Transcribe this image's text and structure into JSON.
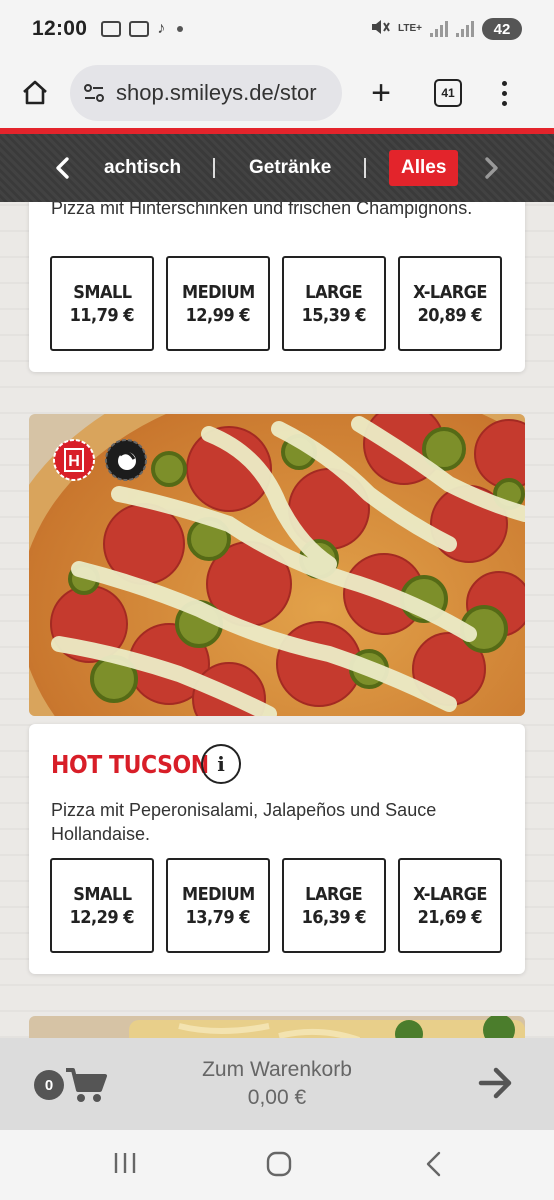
{
  "status_bar": {
    "time": "12:00",
    "network": "LTE+",
    "battery": "42"
  },
  "browser": {
    "url": "shop.smileys.de/stor",
    "tab_count": "41"
  },
  "categories": {
    "items": [
      "achtisch",
      "Getränke",
      "Alles"
    ],
    "active": "Alles"
  },
  "products": [
    {
      "description": "Pizza mit Hinterschinken und frischen Champignons.",
      "sizes": [
        {
          "name": "SMALL",
          "price": "11,79 €"
        },
        {
          "name": "MEDIUM",
          "price": "12,99 €"
        },
        {
          "name": "LARGE",
          "price": "15,39 €"
        },
        {
          "name": "X-LARGE",
          "price": "20,89 €"
        }
      ]
    },
    {
      "title": "HOT TUCSON",
      "info_icon": "info-icon",
      "badges": [
        "H",
        "chili"
      ],
      "description": "Pizza mit Peperonisalami, Jalapeños und Sauce Hollandaise.",
      "sizes": [
        {
          "name": "SMALL",
          "price": "12,29 €"
        },
        {
          "name": "MEDIUM",
          "price": "13,79 €"
        },
        {
          "name": "LARGE",
          "price": "16,39 €"
        },
        {
          "name": "X-LARGE",
          "price": "21,69 €"
        }
      ]
    }
  ],
  "cart": {
    "count": "0",
    "label": "Zum Warenkorb",
    "total": "0,00 €"
  },
  "colors": {
    "brand_red": "#e3242b",
    "title_red": "#d81e28",
    "nav_dark": "#3c3c3c"
  }
}
